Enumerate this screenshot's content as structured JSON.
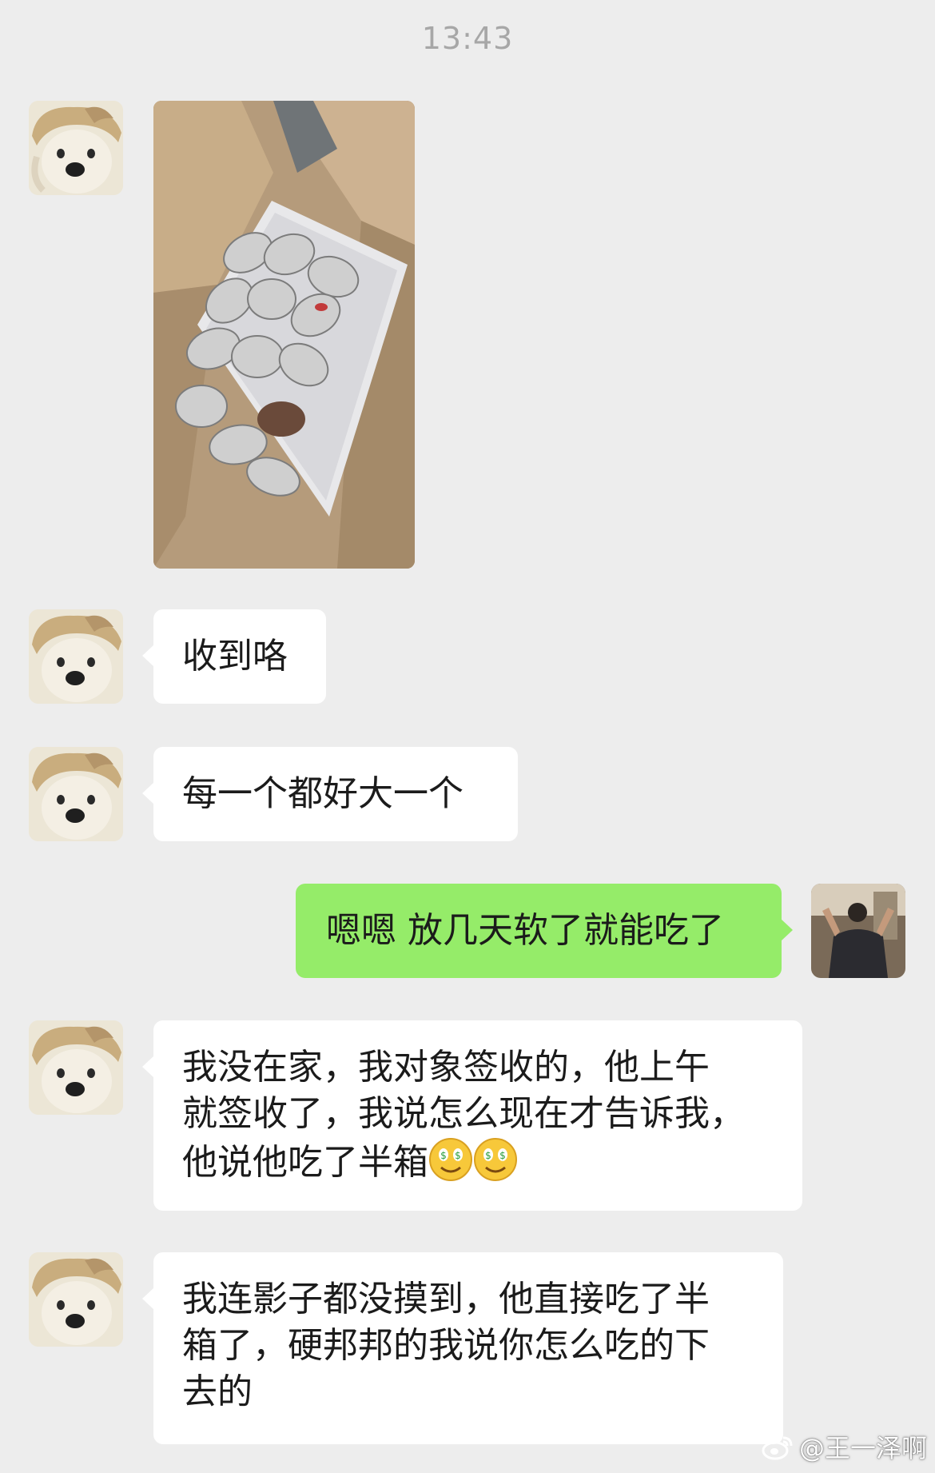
{
  "timestamp": "13:43",
  "messages": [
    {
      "side": "in",
      "type": "image",
      "alt": "box of netted fruit"
    },
    {
      "side": "in",
      "type": "text",
      "text": "收到咯"
    },
    {
      "side": "in",
      "type": "text",
      "text": "每一个都好大一个"
    },
    {
      "side": "out",
      "type": "text",
      "text": "嗯嗯 放几天软了就能吃了"
    },
    {
      "side": "in",
      "type": "text",
      "lines": [
        "我没在家，我对象签收的，他上午",
        "就签收了，我说怎么现在才告诉我，",
        "他说他吃了半箱"
      ],
      "emoji": [
        "money-mouth-emoji",
        "money-mouth-emoji"
      ]
    },
    {
      "side": "in",
      "type": "text",
      "lines": [
        "我连影子都没摸到，他直接吃了半",
        "箱了，硬邦邦的我说你怎么吃的下",
        "去的"
      ]
    }
  ],
  "watermark": "@王一泽啊",
  "colors": {
    "background": "#ededed",
    "incoming_bubble": "#ffffff",
    "outgoing_bubble": "#95ec69",
    "timestamp": "#a7a7a7"
  }
}
